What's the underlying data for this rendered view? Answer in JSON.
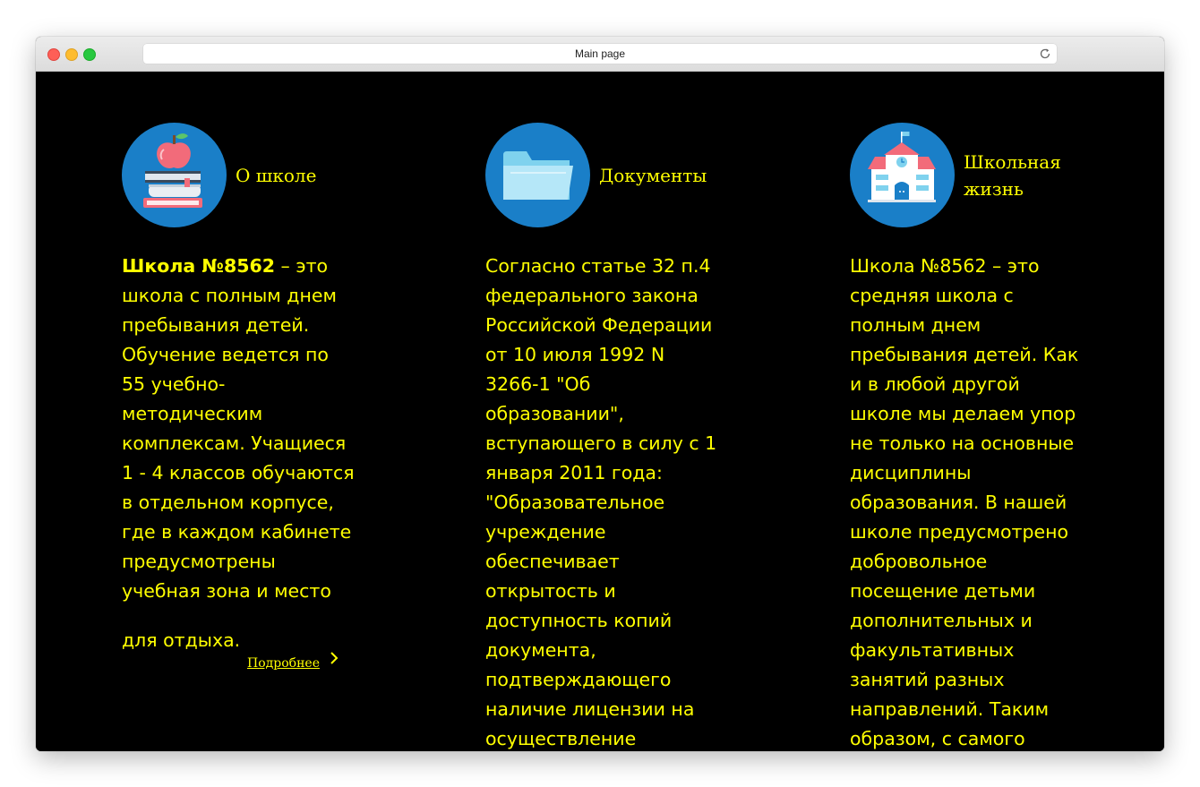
{
  "browser": {
    "title": "Main page"
  },
  "columns": [
    {
      "title": "О школе",
      "icon": "books-apple-icon",
      "lead_bold": "Школа №8562",
      "text": " – это школа с полным днем пребывания детей. Обучение ведется по 55 учебно-методическим комплексам. Учащиеся 1 - 4 классов обучаются в отдельном корпусе, где в каждом кабинете предусмотрены учебная зона и место",
      "last_line": "для отдыха.",
      "more_label": "Подробнее"
    },
    {
      "title": "Документы",
      "icon": "folder-icon",
      "text": "Согласно статье 32 п.4 федерального закона Российской Федерации от 10 июля 1992 N 3266-1 \"Об образовании\", вступающего в силу с 1 января 2011 года: \"Образовательное учреждение обеспечивает открытость и доступность копий документа, подтверждающего наличие лицензии на осуществление"
    },
    {
      "title": "Школьная жизнь",
      "icon": "school-building-icon",
      "text": "Школа №8562 – это средняя школа с полным днем пребывания детей. Как и в любой другой школе мы делаем упор не только на основные дисциплины образования. В нашей школе предусмотрено добровольное посещение детьми дополнительных и факультативных занятий разных направлений. Таким образом, с самого"
    }
  ],
  "colors": {
    "background": "#000000",
    "text": "#ffff00",
    "icon_circle": "#1a7fc8"
  }
}
